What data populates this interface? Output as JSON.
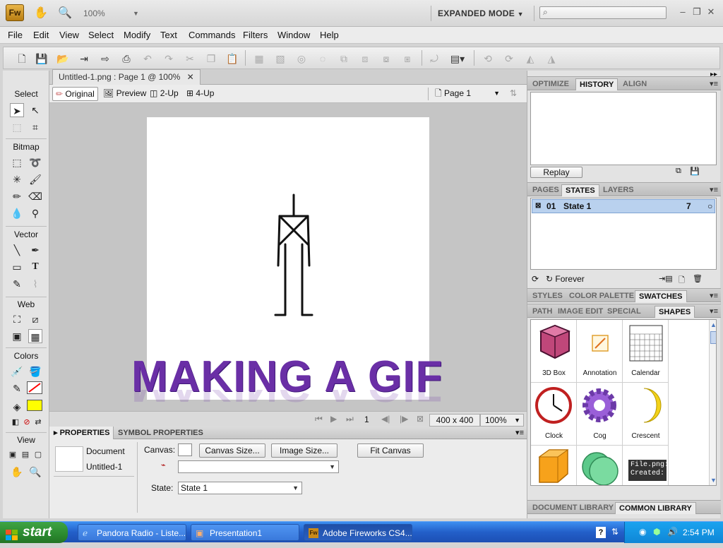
{
  "app": {
    "logo": "Fw",
    "zoom": "100%",
    "workspace_mode": "EXPANDED MODE",
    "search_placeholder": ""
  },
  "menu": [
    "File",
    "Edit",
    "View",
    "Select",
    "Modify",
    "Text",
    "Commands",
    "Filters",
    "Window",
    "Help"
  ],
  "tools": {
    "sections": [
      "Select",
      "Bitmap",
      "Vector",
      "Web",
      "Colors",
      "View"
    ],
    "fill_color": "#ffff00",
    "stroke_color": "#ff0000"
  },
  "document": {
    "tab_title": "Untitled-1.png : Page 1 @ 100%",
    "views": [
      "Original",
      "Preview",
      "2-Up",
      "4-Up"
    ],
    "page_select": "Page 1",
    "canvas_text": "MAKING A GIF",
    "status": {
      "frame": "1",
      "size": "400 x 400",
      "zoom": "100%"
    }
  },
  "properties": {
    "tabs": [
      "PROPERTIES",
      "SYMBOL PROPERTIES"
    ],
    "doc_type": "Document",
    "doc_name": "Untitled-1",
    "canvas_label": "Canvas:",
    "canvas_size_btn": "Canvas Size...",
    "image_size_btn": "Image Size...",
    "fit_canvas_btn": "Fit Canvas",
    "state_label": "State:",
    "state_value": "State 1"
  },
  "panels": {
    "top_tabs": [
      "OPTIMIZE",
      "HISTORY",
      "ALIGN"
    ],
    "replay_btn": "Replay",
    "mid_tabs": [
      "PAGES",
      "STATES",
      "LAYERS"
    ],
    "state_row": {
      "num": "01",
      "name": "State 1",
      "delay": "7"
    },
    "loop": "Forever",
    "swatch_tabs": [
      "STYLES",
      "COLOR PALETTE",
      "SWATCHES"
    ],
    "shape_tabs": [
      "PATH",
      "IMAGE EDIT",
      "SPECIAL CH/",
      "SHAPES"
    ],
    "shapes": [
      "3D Box",
      "Annotation",
      "Calendar",
      "Clock",
      "Cog",
      "Crescent"
    ],
    "tooltip": [
      "File.png:",
      "Created:"
    ],
    "bottom_tabs": [
      "DOCUMENT LIBRARY",
      "COMMON LIBRARY"
    ]
  },
  "taskbar": {
    "start": "start",
    "tasks": [
      "Pandora Radio - Liste...",
      "Presentation1",
      "Adobe Fireworks CS4..."
    ],
    "clock": "2:54 PM"
  }
}
